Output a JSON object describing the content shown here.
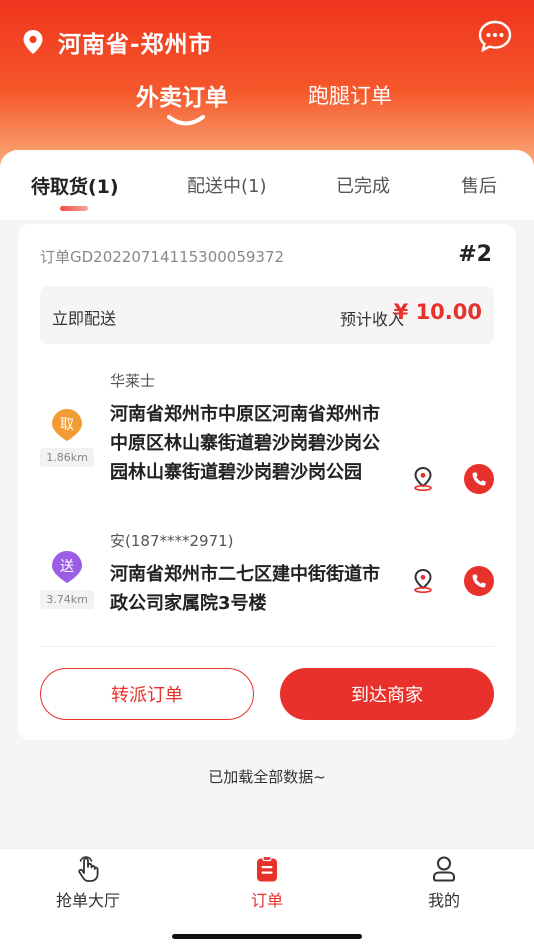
{
  "header": {
    "location": "河南省-郑州市",
    "tabs": [
      {
        "label": "外卖订单",
        "active": true
      },
      {
        "label": "跑腿订单",
        "active": false
      }
    ]
  },
  "status_tabs": [
    {
      "label": "待取货(1)",
      "active": true
    },
    {
      "label": "配送中(1)",
      "active": false
    },
    {
      "label": "已完成",
      "active": false
    },
    {
      "label": "售后",
      "active": false
    }
  ],
  "order": {
    "order_no": "订单GD20220714115300059372",
    "seq": "#2",
    "delivery_type": "立即配送",
    "income_label": "预计收入",
    "income_value": "¥ 10.00",
    "pickup": {
      "badge": "取",
      "distance": "1.86km",
      "name": "华莱士",
      "address": "河南省郑州市中原区河南省郑州市中原区林山寨街道碧沙岗碧沙岗公园林山寨街道碧沙岗碧沙岗公园"
    },
    "deliver": {
      "badge": "送",
      "distance": "3.74km",
      "name": "安(187****2971)",
      "address": "河南省郑州市二七区建中街街道市政公司家属院3号楼"
    },
    "transfer_button": "转派订单",
    "arrive_button": "到达商家"
  },
  "footer_note": "已加载全部数据~",
  "bottom_nav": [
    {
      "label": "抢单大厅",
      "icon": "hand-tap-icon",
      "active": false
    },
    {
      "label": "订单",
      "icon": "clipboard-icon",
      "active": true
    },
    {
      "label": "我的",
      "icon": "user-icon",
      "active": false
    }
  ],
  "colors": {
    "accent": "#e8312a",
    "pickup_badge": "#f39c34",
    "deliver_badge": "#9b5de5"
  }
}
